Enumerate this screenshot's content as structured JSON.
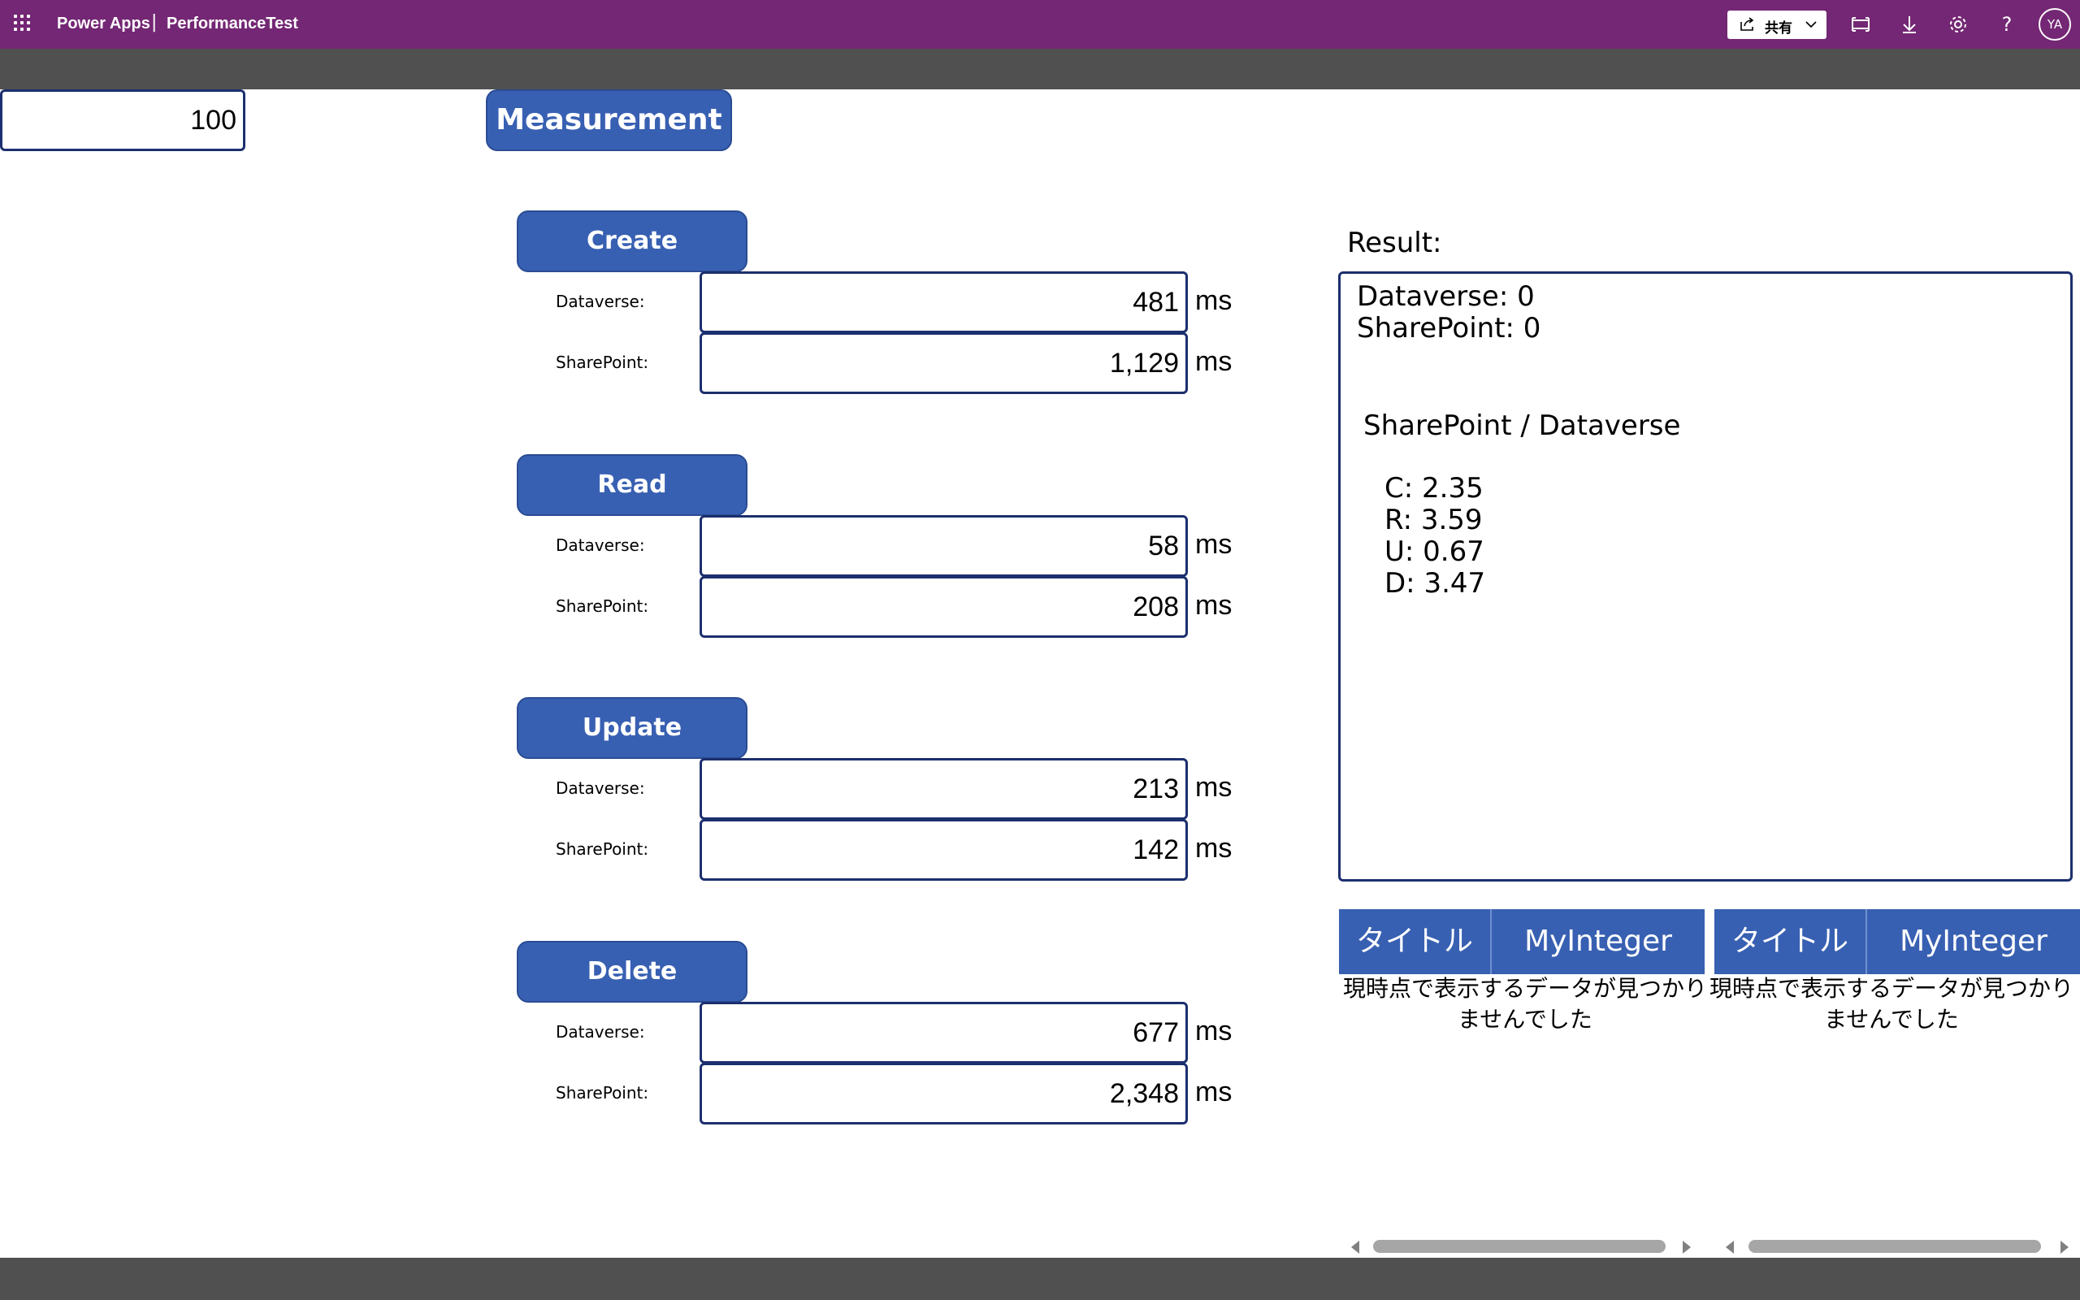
{
  "header": {
    "app_title": "Power Apps",
    "separator": "|",
    "app_name": "PerformanceTest",
    "share_label": "共有",
    "avatar_initials": "YA",
    "icons": [
      "waffle-icon",
      "share-icon",
      "chevron-down-icon",
      "fit-screen-icon",
      "download-icon",
      "settings-icon",
      "help-icon"
    ],
    "help_glyph": "?",
    "color": "#742774"
  },
  "count_input": {
    "value": "100"
  },
  "measurement_button": {
    "label": "Measurement"
  },
  "sections": [
    {
      "button": "Create",
      "dataverse_label": "Dataverse:",
      "dataverse_value": "481",
      "sharepoint_label": "SharePoint:",
      "sharepoint_value": "1,129",
      "unit": "ms"
    },
    {
      "button": "Read",
      "dataverse_label": "Dataverse:",
      "dataverse_value": "58",
      "sharepoint_label": "SharePoint:",
      "sharepoint_value": "208",
      "unit": "ms"
    },
    {
      "button": "Update",
      "dataverse_label": "Dataverse:",
      "dataverse_value": "213",
      "sharepoint_label": "SharePoint:",
      "sharepoint_value": "142",
      "unit": "ms"
    },
    {
      "button": "Delete",
      "dataverse_label": "Dataverse:",
      "dataverse_value": "677",
      "sharepoint_label": "SharePoint:",
      "sharepoint_value": "2,348",
      "unit": "ms"
    }
  ],
  "result": {
    "label": "Result:",
    "lines": [
      "Dataverse: 0",
      "SharePoint: 0"
    ],
    "ratio_title": "SharePoint / Dataverse",
    "ratios": [
      "C: 2.35",
      "R: 3.59",
      "U: 0.67",
      "D: 3.47"
    ]
  },
  "galleries": [
    {
      "col1": "タイトル",
      "col2": "MyInteger",
      "empty_line1": "現時点で表示するデータが見つかり",
      "empty_line2": "ませんでした"
    },
    {
      "col1": "タイトル",
      "col2": "MyInteger",
      "empty_line1": "現時点で表示するデータが見つかり",
      "empty_line2": "ませんでした"
    }
  ],
  "colors": {
    "button": "#3860b2",
    "border": "#1c2f6e",
    "gray_bar": "#505050"
  }
}
